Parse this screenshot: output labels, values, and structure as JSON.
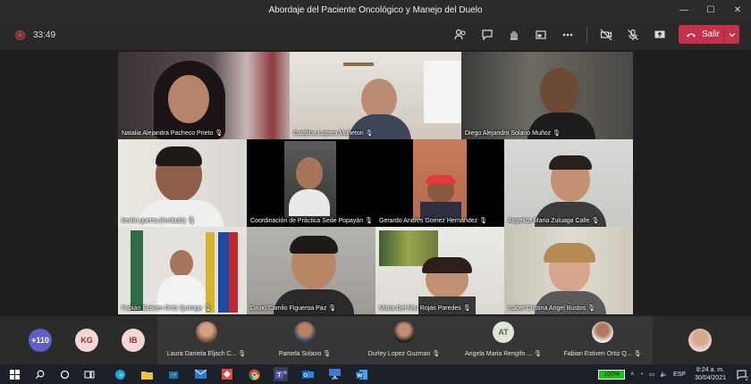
{
  "window": {
    "title": "Abordaje del Paciente Oncológico y Manejo del Duelo",
    "minimize": "—",
    "maximize": "☐",
    "close": "✕"
  },
  "toolbar": {
    "timer": "33:49",
    "leave_label": "Salir"
  },
  "colors": {
    "accent": "#c4314b",
    "background": "#1f1f1f",
    "battery": "#16c60c"
  },
  "participants": [
    {
      "name": "Natalia Alejandra Pacheco Prieto"
    },
    {
      "name": "Catalina Lopera Muñeton"
    },
    {
      "name": "Diego Alejandro Solano Muñoz"
    },
    {
      "name": "kevim guerra (Invitado)"
    },
    {
      "name": "Coordinación de Práctica Sede Popayán"
    },
    {
      "name": "Gerardo Andres Gomez Hernandez"
    },
    {
      "name": "Angelica Maria Zuluaga Calle"
    },
    {
      "name": "Fabián Estiven Ortiz Quiroga"
    },
    {
      "name": "David Camilo Figueroa Paz"
    },
    {
      "name": "Maria Del Mar Rojas Paredes"
    },
    {
      "name": "Isabel Cristina Angel Bustos"
    }
  ],
  "roster": {
    "overflow": "+110",
    "badges": [
      "KG",
      "IB"
    ],
    "people": [
      {
        "name": "Laura Daniela Eljach C..."
      },
      {
        "name": "Pamela Solano"
      },
      {
        "name": "Durley Lopez Guzman"
      },
      {
        "name": "Angela Maria Rengifo ...",
        "initials": "AT"
      },
      {
        "name": "Fabian Estiven Ortiz Q..."
      }
    ]
  },
  "taskbar": {
    "battery": "100%",
    "time": "8:24 a. m.",
    "date": "30/04/2021",
    "language": "ESP",
    "notifications": "2"
  }
}
